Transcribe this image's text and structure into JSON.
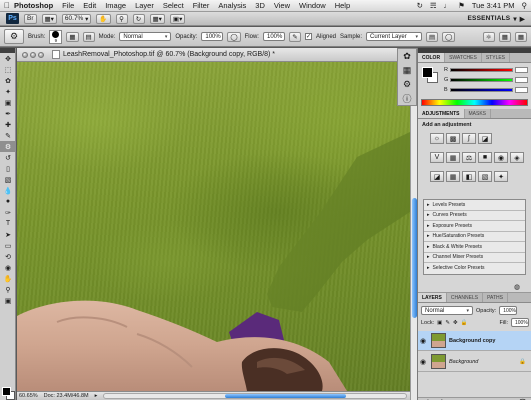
{
  "menubar": {
    "app_name": "Photoshop",
    "items": [
      "File",
      "Edit",
      "Image",
      "Layer",
      "Select",
      "Filter",
      "Analysis",
      "3D",
      "View",
      "Window",
      "Help"
    ],
    "clock": "Tue 3:41 PM"
  },
  "appbar": {
    "logo": "Ps",
    "zoom_value": "60.7%",
    "workspace": "ESSENTIALS"
  },
  "options": {
    "brush_label": "Brush:",
    "brush_size": "9",
    "mode_label": "Mode:",
    "mode_value": "Normal",
    "opacity_label": "Opacity:",
    "opacity_value": "100%",
    "flow_label": "Flow:",
    "flow_value": "100%",
    "aligned_label": "Aligned",
    "sample_label": "Sample:",
    "sample_value": "Current Layer"
  },
  "document": {
    "title": "LeashRemoval_Photoshop.tif @ 60.7% (Background copy, RGB/8) *",
    "status_zoom": "60.65%",
    "doc_size": "Doc: 23.4M/46.8M"
  },
  "panels": {
    "color_tabs": [
      "COLOR",
      "SWATCHES",
      "STYLES"
    ],
    "rgb_labels": [
      "R",
      "G",
      "B"
    ],
    "adj_tabs": [
      "ADJUSTMENTS",
      "MASKS"
    ],
    "adj_title": "Add an adjustment",
    "presets": [
      "Levels Presets",
      "Curves Presets",
      "Exposure Presets",
      "Hue/Saturation Presets",
      "Black & White Presets",
      "Channel Mixer Presets",
      "Selective Color Presets"
    ],
    "layer_tabs": [
      "LAYERS",
      "CHANNELS",
      "PATHS"
    ],
    "blend_mode": "Normal",
    "opacity_label": "Opacity:",
    "opacity_value": "100%",
    "lock_label": "Lock:",
    "fill_label": "Fill:",
    "fill_value": "100%",
    "layers": [
      "Background copy",
      "Background"
    ]
  },
  "colors": {
    "grass": "#7a962c",
    "fur": "#cfa58f",
    "leash": "#5a2a7a",
    "selection": "#b5d4f5"
  }
}
